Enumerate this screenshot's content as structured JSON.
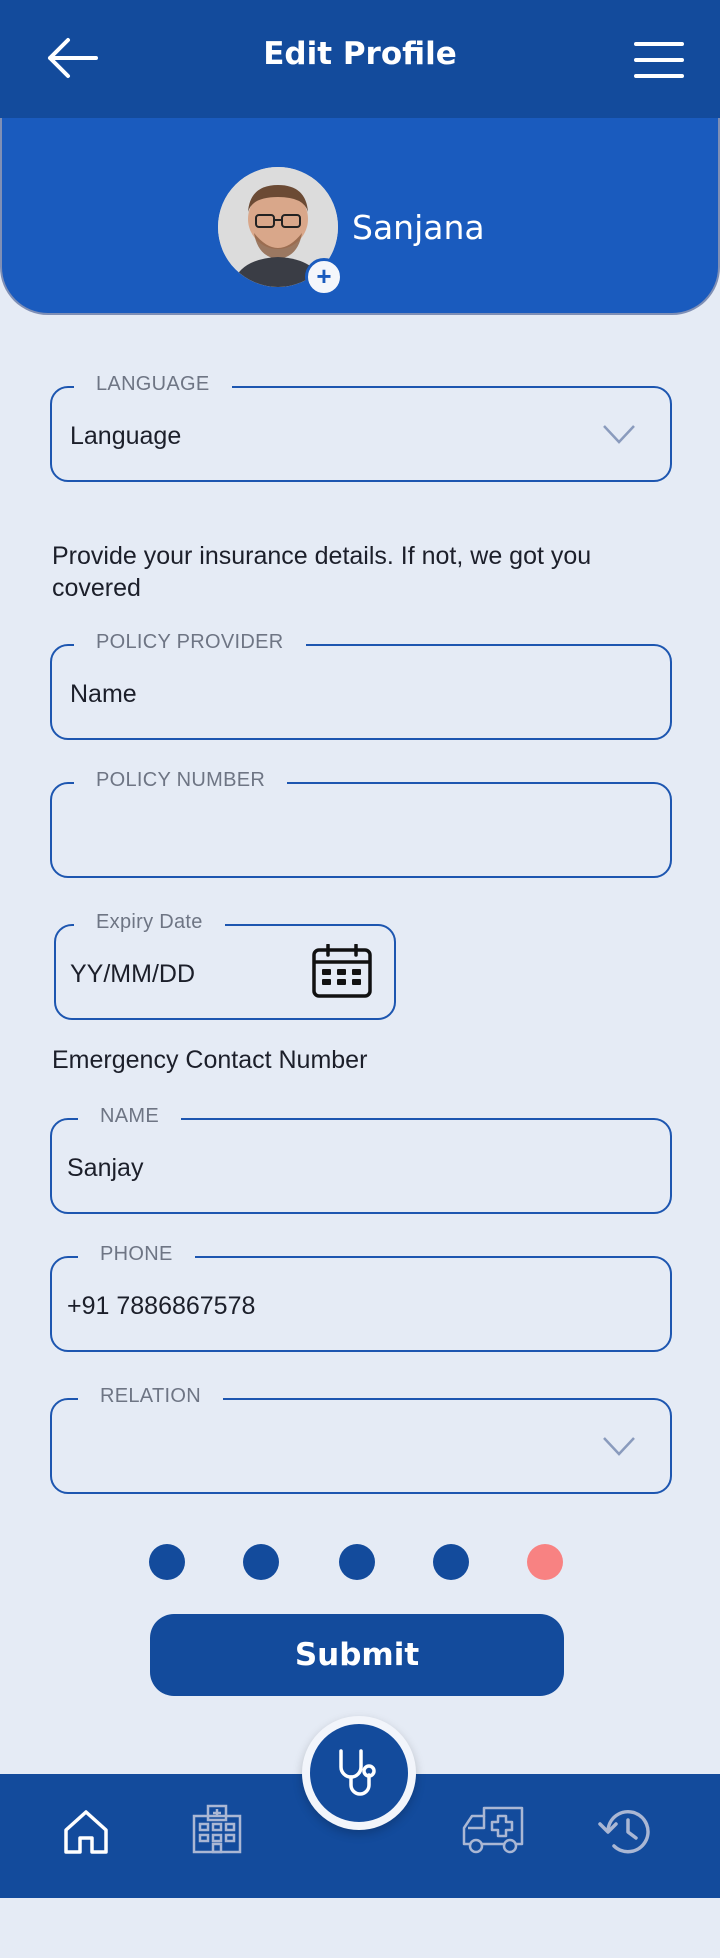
{
  "header": {
    "title": "Edit Profile"
  },
  "profile": {
    "name": "Sanjana"
  },
  "language": {
    "legend": "LANGUAGE",
    "value": "Language"
  },
  "insurance": {
    "info": "Provide your insurance details. If not, we got you covered",
    "provider": {
      "legend": "POLICY PROVIDER",
      "value": "Name"
    },
    "number": {
      "legend": "POLICY NUMBER",
      "value": ""
    },
    "expiry": {
      "legend": "Expiry Date",
      "value": "YY/MM/DD"
    }
  },
  "emergency": {
    "heading": "Emergency Contact Number",
    "name": {
      "legend": "NAME",
      "value": "Sanjay"
    },
    "phone": {
      "legend": "PHONE",
      "value": "+91 7886867578"
    },
    "relation": {
      "legend": "RELATION",
      "value": ""
    }
  },
  "pagination": {
    "total": 5,
    "active_index": 4
  },
  "submit_label": "Submit",
  "colors": {
    "primary": "#134b9c",
    "card": "#1a5bbe",
    "background": "#e5ebf5",
    "active_dot": "#f88282"
  },
  "nav": {
    "items": [
      "home-icon",
      "hospital-icon",
      "stethoscope-icon",
      "ambulance-icon",
      "history-icon"
    ]
  }
}
